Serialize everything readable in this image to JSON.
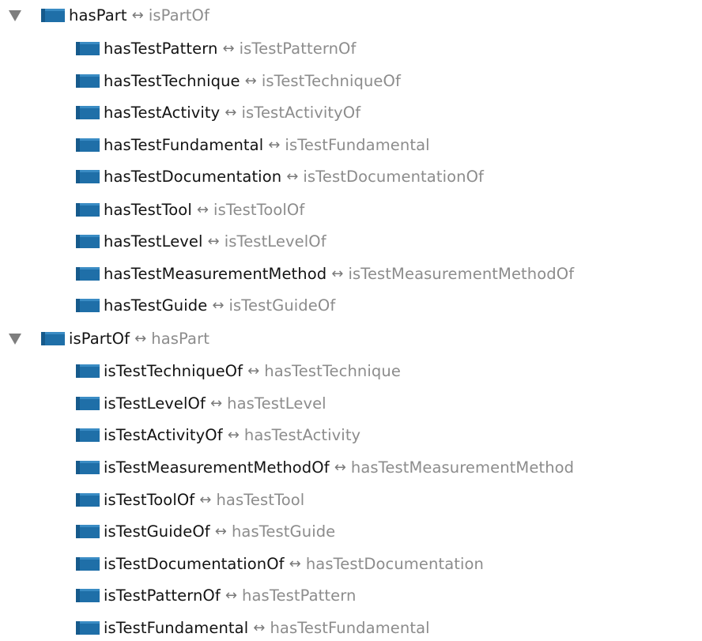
{
  "accent_color": "#1f6fa8",
  "icons": {
    "property": "object-property-icon",
    "expand": "expand-triangle-icon"
  },
  "arrow_glyph": "↔",
  "groups": [
    {
      "name": "hasPart",
      "inverse": "isPartOf",
      "children": [
        {
          "name": "hasTestPattern",
          "inverse": "isTestPatternOf"
        },
        {
          "name": "hasTestTechnique",
          "inverse": "isTestTechniqueOf"
        },
        {
          "name": "hasTestActivity",
          "inverse": "isTestActivityOf"
        },
        {
          "name": "hasTestFundamental",
          "inverse": "isTestFundamental"
        },
        {
          "name": "hasTestDocumentation",
          "inverse": "isTestDocumentationOf"
        },
        {
          "name": "hasTestTool",
          "inverse": "isTestToolOf"
        },
        {
          "name": "hasTestLevel",
          "inverse": "isTestLevelOf"
        },
        {
          "name": "hasTestMeasurementMethod",
          "inverse": "isTestMeasurementMethodOf"
        },
        {
          "name": "hasTestGuide",
          "inverse": "isTestGuideOf"
        }
      ]
    },
    {
      "name": "isPartOf",
      "inverse": "hasPart",
      "children": [
        {
          "name": "isTestTechniqueOf",
          "inverse": "hasTestTechnique"
        },
        {
          "name": "isTestLevelOf",
          "inverse": "hasTestLevel"
        },
        {
          "name": "isTestActivityOf",
          "inverse": "hasTestActivity"
        },
        {
          "name": "isTestMeasurementMethodOf",
          "inverse": "hasTestMeasurementMethod"
        },
        {
          "name": "isTestToolOf",
          "inverse": "hasTestTool"
        },
        {
          "name": "isTestGuideOf",
          "inverse": "hasTestGuide"
        },
        {
          "name": "isTestDocumentationOf",
          "inverse": "hasTestDocumentation"
        },
        {
          "name": "isTestPatternOf",
          "inverse": "hasTestPattern"
        },
        {
          "name": "isTestFundamental",
          "inverse": "hasTestFundamental"
        }
      ]
    }
  ]
}
